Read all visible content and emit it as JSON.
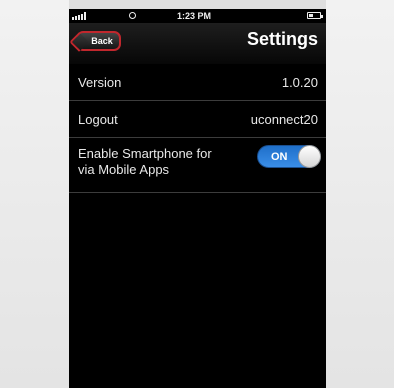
{
  "status_bar": {
    "time": "1:23 PM",
    "signal_icon": "signal-bars-icon",
    "wifi_icon": "wifi-icon",
    "battery_icon": "battery-icon"
  },
  "navbar": {
    "back_label": "Back",
    "title": "Settings",
    "back_border_color": "#c1272d"
  },
  "settings": {
    "version": {
      "label": "Version",
      "value": "1.0.20"
    },
    "logout": {
      "label": "Logout",
      "value": "uconnect20"
    },
    "enable_smartphone": {
      "label_line1": "Enable Smartphone for",
      "label_line2": "via Mobile Apps",
      "toggle_state": "ON",
      "toggle_color": "#2f80dc"
    }
  }
}
